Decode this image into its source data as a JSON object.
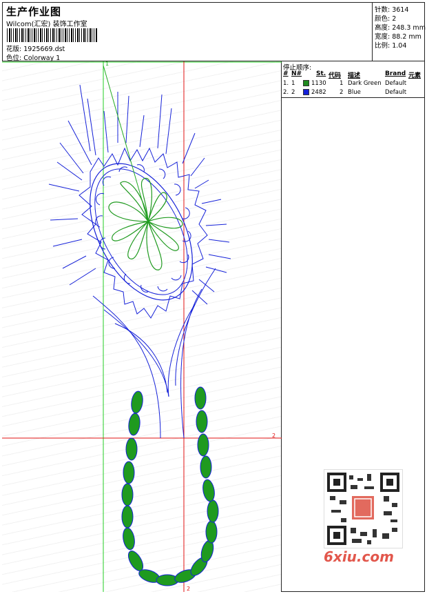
{
  "header": {
    "title": "生产作业图",
    "studio": "Wilcom(汇宏) 装饰工作室",
    "design_label": "花版:",
    "design_value": "1925669.dst",
    "colorway_label": "色位:",
    "colorway_value": "Colorway 1"
  },
  "stats": {
    "stitches": "针数: 3614",
    "colors": "颜色: 2",
    "height": "高度: 248.3 mm",
    "width": "宽度: 88.2 mm",
    "scale": "比例: 1.04"
  },
  "stop_sequence": {
    "title": "停止顺序:",
    "headers": [
      "#",
      "N#",
      "St.",
      "代码",
      "描述",
      "Brand",
      "元素"
    ],
    "rows": [
      {
        "idx": "1.",
        "n": "1",
        "stitches": "1130",
        "code": "1",
        "desc": "Dark Green",
        "brand": "Default",
        "color": "#1f8a1f"
      },
      {
        "idx": "2.",
        "n": "2",
        "stitches": "2482",
        "code": "2",
        "desc": "Blue",
        "brand": "Default",
        "color": "#1420d8"
      }
    ]
  },
  "markers": {
    "top": "1",
    "right": "2",
    "bottom": "2"
  },
  "watermark": "6xiu.com",
  "colors": {
    "green_guide": "#22cc22",
    "red_guide": "#e01010",
    "thread_blue": "#1420d8",
    "thread_green": "#1f9a1f"
  }
}
